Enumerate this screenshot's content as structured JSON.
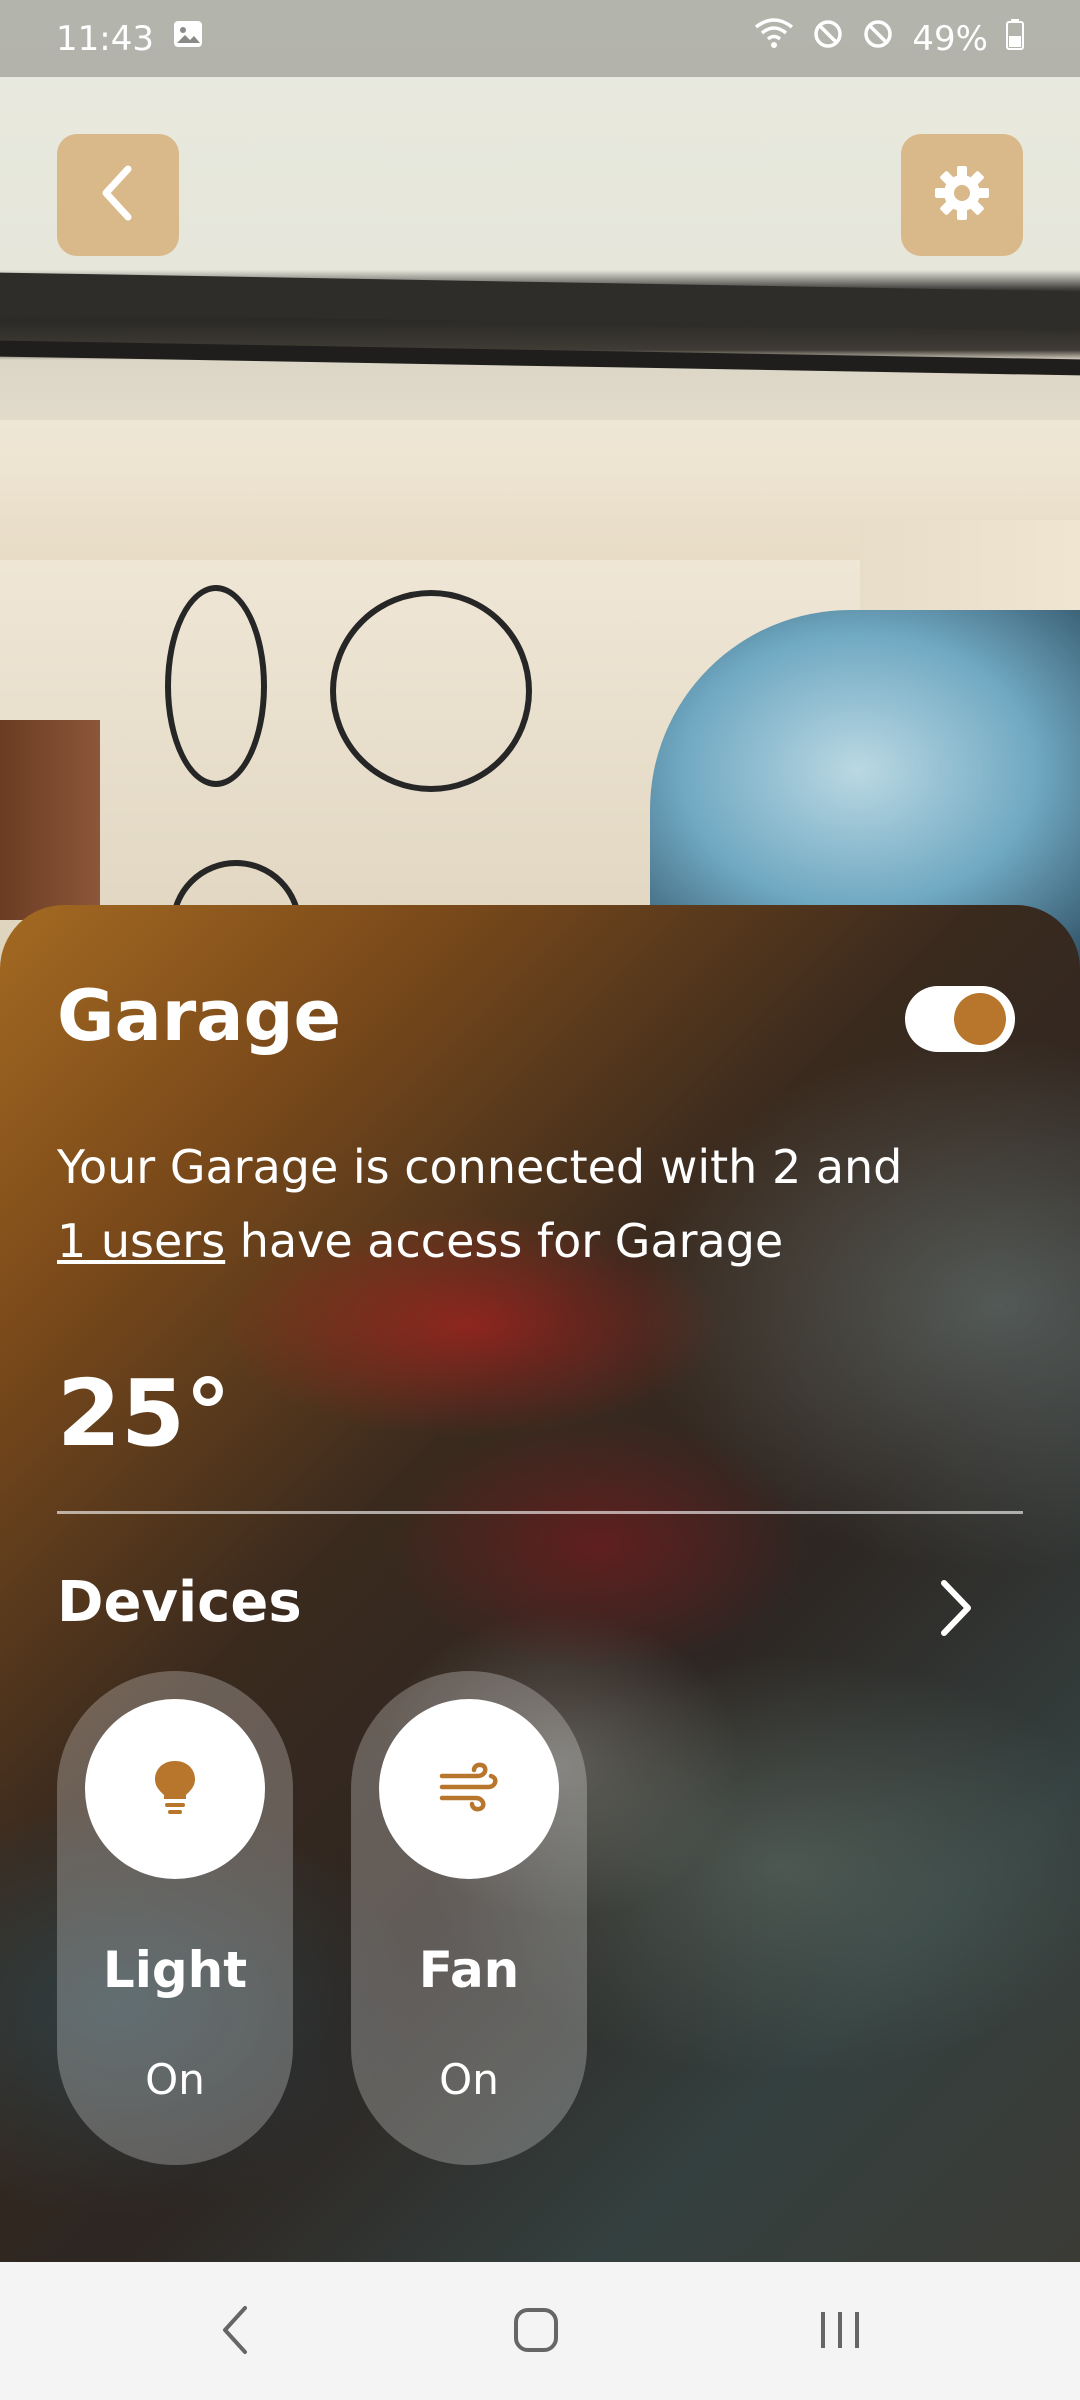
{
  "status_bar": {
    "time": "11:43",
    "battery": "49%",
    "icons": [
      "gallery-icon",
      "wifi-icon",
      "blocked-icon",
      "blocked-icon",
      "battery-icon"
    ]
  },
  "header": {
    "back_icon": "chevron-left-icon",
    "settings_icon": "gear-icon"
  },
  "room": {
    "name": "Garage",
    "toggle_on": true,
    "description_prefix": "Your Garage is connected with 2 and ",
    "users_link": "1 users",
    "description_suffix": " have access for Garage",
    "temperature": "25°"
  },
  "devices": {
    "title": "Devices",
    "items": [
      {
        "name": "Light",
        "state": "On",
        "icon": "lightbulb-icon"
      },
      {
        "name": "Fan",
        "state": "On",
        "icon": "wind-icon"
      }
    ]
  },
  "nav_bar": {
    "icons": [
      "back-nav-icon",
      "home-nav-icon",
      "recents-nav-icon"
    ]
  },
  "colors": {
    "accent": "#b7762c",
    "button_bg": "#d9b88a",
    "text": "#ffffff",
    "nav_bg": "#f4f4f4"
  }
}
